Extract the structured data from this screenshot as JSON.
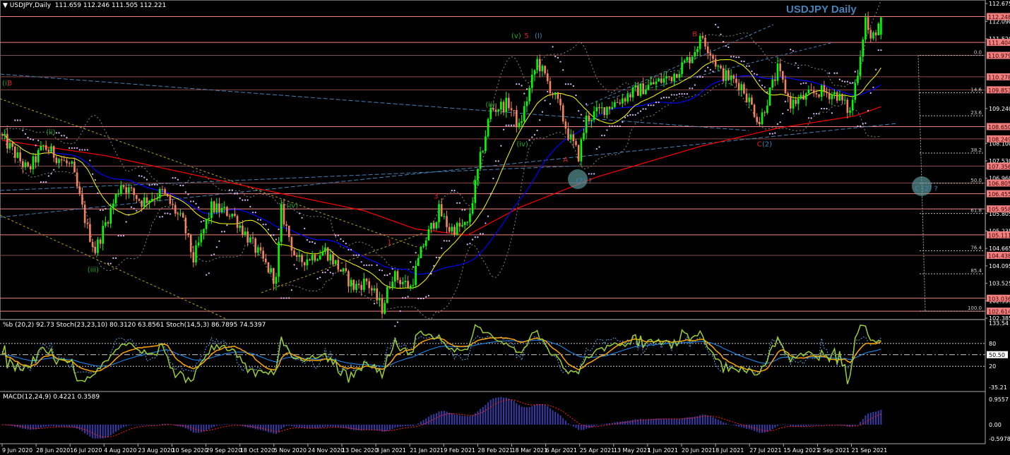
{
  "header": {
    "symbol": "USDJPY,Daily",
    "ohlc": "111.659 112.246 111.505 112.221",
    "chart_title": "USDJPY Daily",
    "osc_header": "%b (20,2) 92.73  Stoch(23,23,10) 80.3120 63.8561  Stoch(14,5,3) 86.7895 74.5397",
    "macd_header": "MACD(12,24,9) 0.4221 0.3589"
  },
  "colors": {
    "bull": "#00ff00",
    "bear": "#f4845f",
    "level": "#f08080",
    "level_dark": "#8b4a4a",
    "title": "#4682b4",
    "ma_fast": "#ffff00",
    "ma_mid": "#0000ff",
    "ma_slow": "#ff0000",
    "macd_hist": "#3a3aa8"
  },
  "chart_data": {
    "type": "candlestick",
    "title": "USDJPY Daily",
    "bars": 341,
    "last_bar": {
      "open": 111.659,
      "high": 112.246,
      "low": 111.505,
      "close": 112.221
    },
    "price_path_anchors": [
      [
        0,
        108.3
      ],
      [
        10,
        107.2
      ],
      [
        16,
        108.0
      ],
      [
        27,
        107.3
      ],
      [
        33,
        105.3
      ],
      [
        36,
        104.6
      ],
      [
        46,
        106.8
      ],
      [
        54,
        106.2
      ],
      [
        62,
        106.5
      ],
      [
        70,
        105.5
      ],
      [
        74,
        104.3
      ],
      [
        81,
        106.0
      ],
      [
        89,
        105.8
      ],
      [
        96,
        104.9
      ],
      [
        106,
        103.6
      ],
      [
        108,
        105.9
      ],
      [
        114,
        104.2
      ],
      [
        125,
        104.6
      ],
      [
        136,
        103.4
      ],
      [
        141,
        103.6
      ],
      [
        147,
        102.7
      ],
      [
        151,
        103.8
      ],
      [
        158,
        103.4
      ],
      [
        163,
        104.8
      ],
      [
        169,
        105.9
      ],
      [
        173,
        105.3
      ],
      [
        180,
        105.4
      ],
      [
        185,
        107.6
      ],
      [
        189,
        109.2
      ],
      [
        196,
        109.4
      ],
      [
        200,
        108.6
      ],
      [
        207,
        110.8
      ],
      [
        215,
        109.4
      ],
      [
        219,
        108.4
      ],
      [
        223,
        107.7
      ],
      [
        226,
        108.9
      ],
      [
        234,
        109.3
      ],
      [
        245,
        109.8
      ],
      [
        259,
        110.3
      ],
      [
        266,
        110.9
      ],
      [
        271,
        111.6
      ],
      [
        278,
        110.4
      ],
      [
        286,
        110.0
      ],
      [
        293,
        108.8
      ],
      [
        300,
        110.5
      ],
      [
        305,
        109.4
      ],
      [
        316,
        109.8
      ],
      [
        323,
        109.7
      ],
      [
        328,
        109.1
      ],
      [
        331,
        110.5
      ],
      [
        334,
        112.2
      ],
      [
        336,
        111.4
      ],
      [
        340,
        112.221
      ]
    ],
    "ma200_anchors": [
      [
        0,
        108.2
      ],
      [
        40,
        107.7
      ],
      [
        100,
        106.6
      ],
      [
        140,
        105.9
      ],
      [
        160,
        105.3
      ],
      [
        180,
        105.1
      ],
      [
        200,
        106.0
      ],
      [
        230,
        107.0
      ],
      [
        270,
        108.0
      ],
      [
        300,
        108.6
      ],
      [
        330,
        109.0
      ],
      [
        340,
        109.3
      ]
    ],
    "price_axis": {
      "min": 102.385,
      "max": 112.675,
      "ticks": [
        "112.675",
        "112.090",
        "111.520",
        "109.240",
        "108.100",
        "107.530",
        "106.960",
        "105.805",
        "105.235",
        "104.665",
        "104.095",
        "103.525",
        "102.955",
        "102.385"
      ]
    },
    "levels": [
      {
        "price": 112.248,
        "label": "112.248",
        "bright": true
      },
      {
        "price": 111.404,
        "label": "111.404",
        "bright": true
      },
      {
        "price": 110.979,
        "label": "110.979",
        "bright": false
      },
      {
        "price": 110.278,
        "label": "110.278",
        "bright": false
      },
      {
        "price": 109.853,
        "label": "109.853",
        "bright": false
      },
      {
        "price": 108.65,
        "label": "108.650",
        "bright": true
      },
      {
        "price": 108.249,
        "label": "108.249",
        "bright": false
      },
      {
        "price": 107.356,
        "label": "107.356",
        "bright": false
      },
      {
        "price": 106.805,
        "label": "106.805",
        "bright": false
      },
      {
        "price": 106.455,
        "label": "106.455",
        "bright": true
      },
      {
        "price": 105.958,
        "label": "105.958",
        "bright": true
      },
      {
        "price": 105.111,
        "label": "105.111",
        "bright": true
      },
      {
        "price": 104.438,
        "label": "104.438",
        "bright": false
      },
      {
        "price": 103.036,
        "label": "103.036",
        "bright": true
      },
      {
        "price": 102.614,
        "label": "102.614",
        "bright": true
      }
    ],
    "fibonacci": {
      "high": 110.979,
      "low": 102.614,
      "levels": [
        [
          "0.0",
          0
        ],
        [
          "14.6",
          0.146
        ],
        [
          "23.6",
          0.236
        ],
        [
          "38.2",
          0.382
        ],
        [
          "50.0",
          0.5
        ],
        [
          "61.8",
          0.618
        ],
        [
          "76.4",
          0.764
        ],
        [
          "85.4",
          0.854
        ],
        [
          "100.0",
          1.0
        ]
      ]
    },
    "wave_labels": [
      {
        "text": "(i)",
        "bar": 0,
        "price": 110.0,
        "color": "#22aa22"
      },
      {
        "text": "B",
        "bar": 2,
        "price": 110.0,
        "color": "#dd2222"
      },
      {
        "text": "(ii)",
        "bar": 17,
        "price": 108.4,
        "color": "#22aa22"
      },
      {
        "text": "(iii)",
        "bar": 33,
        "price": 103.9,
        "color": "#22aa22"
      },
      {
        "text": "(iv)",
        "bar": 110,
        "price": 106.0,
        "color": "#22aa22"
      },
      {
        "text": "1",
        "bar": 149,
        "price": 104.8,
        "color": "#dd2222"
      },
      {
        "text": "3",
        "bar": 167,
        "price": 106.3,
        "color": "#dd2222"
      },
      {
        "text": "(i)",
        "bar": 182,
        "price": 106.75,
        "color": "#22aa22"
      },
      {
        "text": "(ii)",
        "bar": 187,
        "price": 109.3,
        "color": "#22aa22"
      },
      {
        "text": "(iv)",
        "bar": 199,
        "price": 108.0,
        "color": "#22aa22"
      },
      {
        "text": "(v)",
        "bar": 197,
        "price": 111.55,
        "color": "#22aa22"
      },
      {
        "text": "5",
        "bar": 202,
        "price": 111.55,
        "color": "#dd2222"
      },
      {
        "text": "(I)",
        "bar": 206,
        "price": 111.55,
        "color": "#4682b4"
      },
      {
        "text": "A",
        "bar": 217,
        "price": 107.5,
        "color": "#dd2222"
      },
      {
        "text": "(2) ?",
        "bar": 222,
        "price": 106.8,
        "color": "#4682b4"
      },
      {
        "text": "B",
        "bar": 267,
        "price": 111.6,
        "color": "#dd2222"
      },
      {
        "text": "C",
        "bar": 292,
        "price": 108.0,
        "color": "#dd2222"
      },
      {
        "text": "(2)",
        "bar": 294,
        "price": 108.0,
        "color": "#4682b4"
      },
      {
        "text": "C (2) ?",
        "bar": 353,
        "price": 106.55,
        "color": "#4682b4"
      }
    ],
    "oscillator_axis": {
      "ticks": [
        "133.54",
        "80",
        "50.50",
        "20",
        "-35.21"
      ]
    },
    "macd_axis": {
      "ticks": [
        "0.9557",
        "0.00",
        "-0.5978"
      ]
    },
    "x_labels": [
      "9 Jun 2020",
      "28 Jun 2020",
      "16 Jul 2020",
      "4 Aug 2020",
      "23 Aug 2020",
      "10 Sep 2020",
      "29 Sep 2020",
      "18 Oct 2020",
      "5 Nov 2020",
      "24 Nov 2020",
      "13 Dec 2020",
      "3 Jan 2021",
      "21 Jan 2021",
      "9 Feb 2021",
      "28 Feb 2021",
      "18 Mar 2021",
      "6 Apr 2021",
      "25 Apr 2021",
      "13 May 2021",
      "1 Jun 2021",
      "20 Jun 2021",
      "8 Jul 2021",
      "27 Jul 2021",
      "15 Aug 2021",
      "2 Sep 2021",
      "21 Sep 2021"
    ]
  }
}
